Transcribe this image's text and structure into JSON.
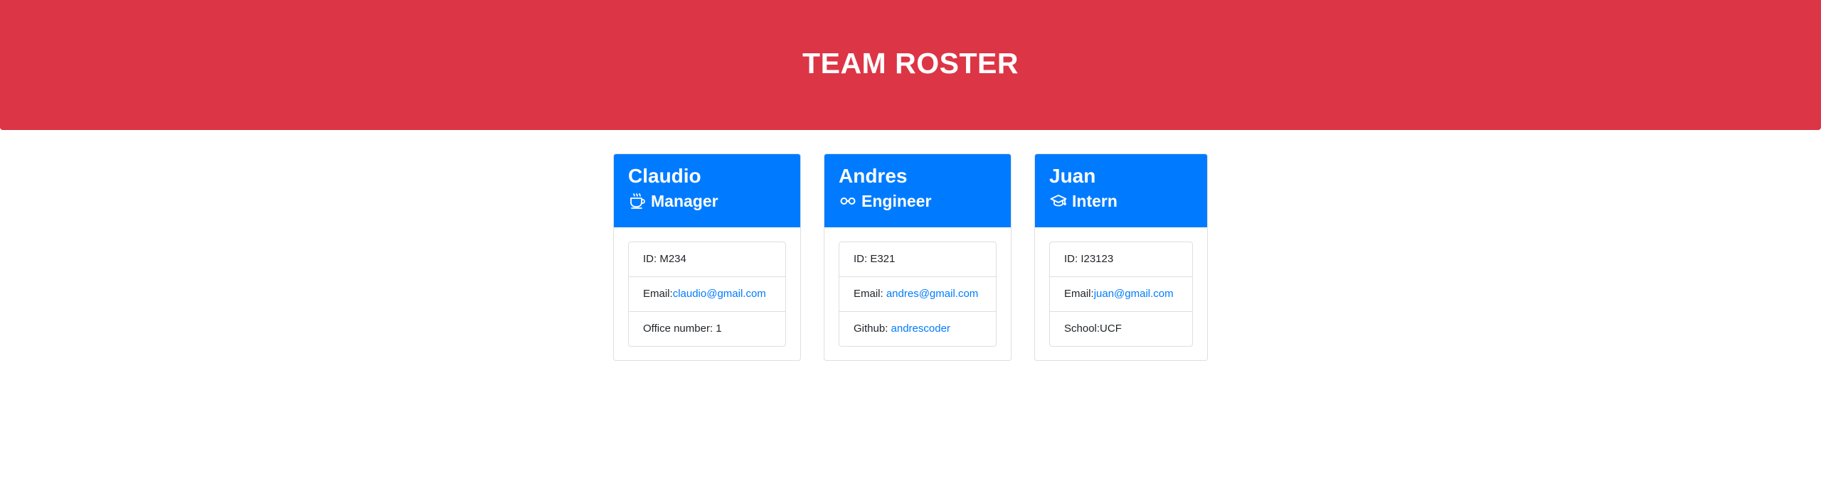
{
  "header": {
    "title": "TEAM ROSTER"
  },
  "colors": {
    "header_bg": "#dc3545",
    "card_head_bg": "#007bff",
    "link": "#007bff"
  },
  "cards": [
    {
      "name": "Claudio",
      "role": "Manager",
      "icon": "coffee-mug-icon",
      "id_label": "ID: M234",
      "email_label": "Email:",
      "email": "claudio@gmail.com",
      "extra_label": "Office number: 1"
    },
    {
      "name": "Andres",
      "role": "Engineer",
      "icon": "glasses-icon",
      "id_label": "ID: E321",
      "email_label": "Email: ",
      "email": "andres@gmail.com",
      "extra_label": "Github: ",
      "extra_link": "andrescoder"
    },
    {
      "name": "Juan",
      "role": "Intern",
      "icon": "graduation-cap-icon",
      "id_label": "ID: I23123",
      "email_label": "Email:",
      "email": "juan@gmail.com",
      "extra_label": "School:UCF"
    }
  ]
}
